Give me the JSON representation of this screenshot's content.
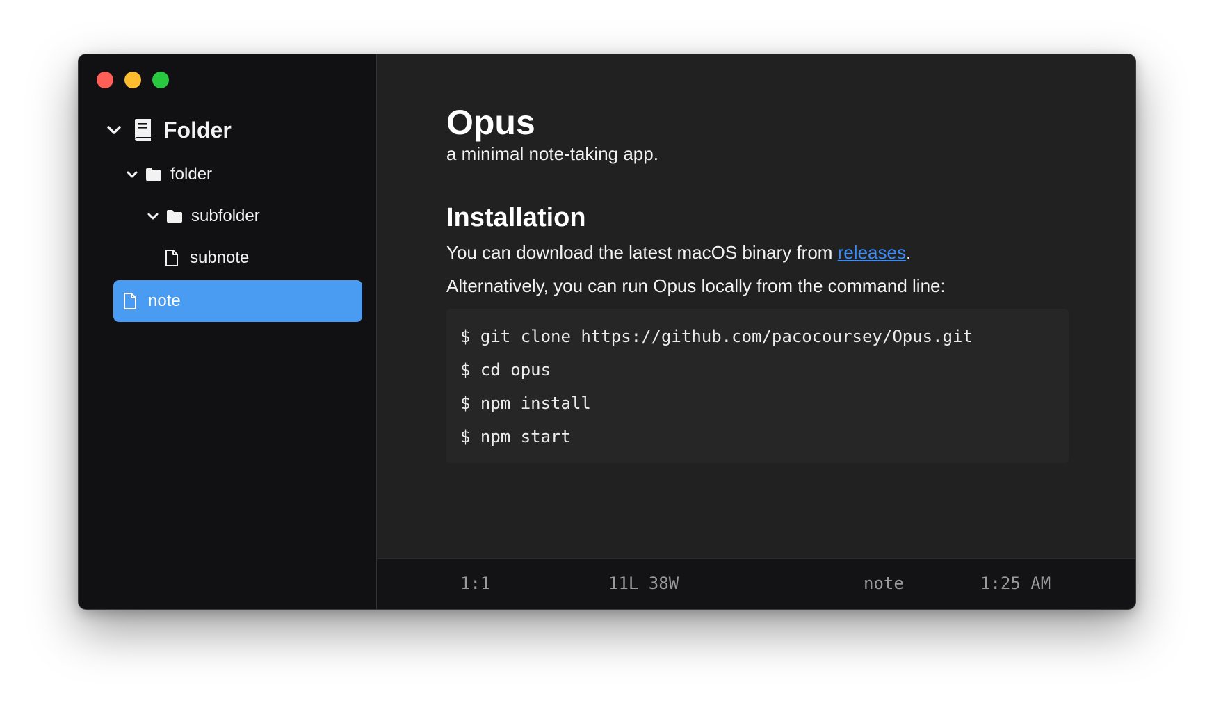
{
  "window": {
    "controls": [
      "close",
      "minimize",
      "zoom"
    ]
  },
  "sidebar": {
    "root": {
      "label": "Folder",
      "icon": "book-icon"
    },
    "items": [
      {
        "label": "folder",
        "icon": "folder-icon",
        "expanded": true
      },
      {
        "label": "subfolder",
        "icon": "folder-icon",
        "expanded": true
      },
      {
        "label": "subnote",
        "icon": "file-icon"
      },
      {
        "label": "note",
        "icon": "file-icon",
        "selected": true
      }
    ]
  },
  "document": {
    "title": "Opus",
    "subtitle": "a minimal note-taking app.",
    "section_heading": "Installation",
    "download_text": "You can download the latest macOS binary from ",
    "download_link": "releases",
    "download_suffix": ".",
    "alternative_text": "Alternatively, you can run Opus locally from the command line:",
    "code_lines": [
      "$ git clone https://github.com/pacocoursey/Opus.git",
      "$ cd opus",
      "$ npm install",
      "$ npm start"
    ]
  },
  "statusbar": {
    "cursor": "1:1",
    "counts": "11L 38W",
    "filename": "note",
    "time": "1:25 AM"
  },
  "colors": {
    "selection": "#4a9cf3",
    "link": "#3b8cf5",
    "sidebar_bg": "#111113",
    "editor_bg": "#212121"
  }
}
